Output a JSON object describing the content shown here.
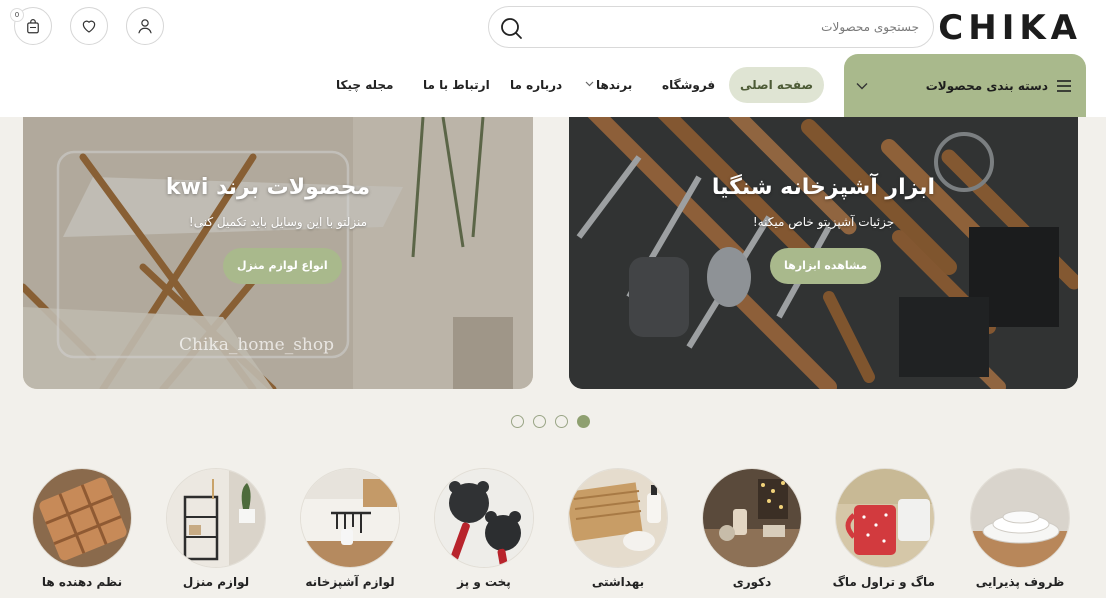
{
  "brand": {
    "logo_text": "CHIKA"
  },
  "search": {
    "placeholder": "جستجوی محصولات"
  },
  "header": {
    "cart_count": "0"
  },
  "nav": {
    "categories_label": "دسته بندی محصولات",
    "items": [
      {
        "label": "صفحه اصلی",
        "active": true
      },
      {
        "label": "فروشگاه"
      },
      {
        "label": "برندها"
      },
      {
        "label": "درباره ما"
      },
      {
        "label": "ارتباط با ما"
      },
      {
        "label": "مجله چیکا"
      }
    ]
  },
  "banners": [
    {
      "title": "ابزار آشپزخانه شنگیا",
      "subtitle": "جزئیات آشپزیتو خاص میکنه!",
      "cta": "مشاهده ابزارها"
    },
    {
      "title": "محصولات برند kwi",
      "subtitle": "منزلتو با این وسایل باید تکمیل کنی!",
      "cta": "انواع لوازم منزل",
      "watermark": "Chika_home_shop"
    }
  ],
  "slider": {
    "dot_count": 4,
    "active_index": 0
  },
  "categories": [
    {
      "label": "ظروف پذیرایی",
      "icon": "plates-icon"
    },
    {
      "label": "ماگ و تراول ماگ",
      "icon": "mug-icon"
    },
    {
      "label": "دکوری",
      "icon": "decor-icon"
    },
    {
      "label": "بهداشتی",
      "icon": "bath-icon"
    },
    {
      "label": "پخت و پز",
      "icon": "pan-icon"
    },
    {
      "label": "لوازم آشپزخانه",
      "icon": "kitchen-icon"
    },
    {
      "label": "لوازم منزل",
      "icon": "home-icon"
    },
    {
      "label": "نظم دهنده ها",
      "icon": "organizer-icon"
    }
  ]
}
